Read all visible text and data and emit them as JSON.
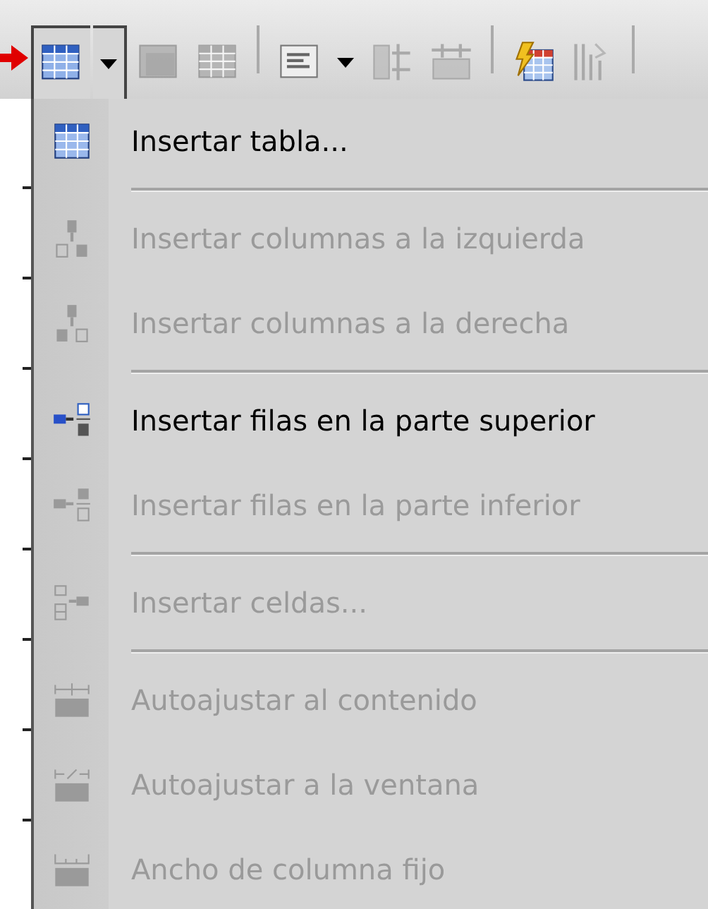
{
  "toolbar": {
    "buttons": [
      {
        "kind": "button",
        "disabled": false,
        "pressed": true
      },
      {
        "kind": "dropdown",
        "disabled": false,
        "pressed": true
      },
      {
        "kind": "button",
        "disabled": true,
        "pressed": false
      },
      {
        "kind": "button",
        "disabled": true,
        "pressed": false
      },
      {
        "kind": "separator"
      },
      {
        "kind": "button",
        "disabled": false,
        "pressed": false
      },
      {
        "kind": "dropdown",
        "disabled": false,
        "pressed": false
      },
      {
        "kind": "button",
        "disabled": true,
        "pressed": false
      },
      {
        "kind": "button",
        "disabled": true,
        "pressed": false
      },
      {
        "kind": "separator"
      },
      {
        "kind": "button",
        "disabled": false,
        "pressed": false
      },
      {
        "kind": "button",
        "disabled": true,
        "pressed": false
      },
      {
        "kind": "separator"
      }
    ]
  },
  "menu": {
    "items": [
      {
        "kind": "item",
        "label": "Insertar tabla...",
        "disabled": false
      },
      {
        "kind": "separator"
      },
      {
        "kind": "item",
        "label": "Insertar columnas a la izquierda",
        "disabled": true
      },
      {
        "kind": "item",
        "label": "Insertar columnas a la derecha",
        "disabled": true
      },
      {
        "kind": "separator"
      },
      {
        "kind": "item",
        "label": "Insertar filas en la parte superior",
        "disabled": false
      },
      {
        "kind": "item",
        "label": "Insertar filas en la parte inferior",
        "disabled": true
      },
      {
        "kind": "separator"
      },
      {
        "kind": "item",
        "label": "Insertar celdas...",
        "disabled": true
      },
      {
        "kind": "separator"
      },
      {
        "kind": "item",
        "label": "Autoajustar al contenido",
        "disabled": true
      },
      {
        "kind": "item",
        "label": "Autoajustar a la ventana",
        "disabled": true
      },
      {
        "kind": "item",
        "label": "Ancho de columna fijo",
        "disabled": true
      }
    ]
  }
}
